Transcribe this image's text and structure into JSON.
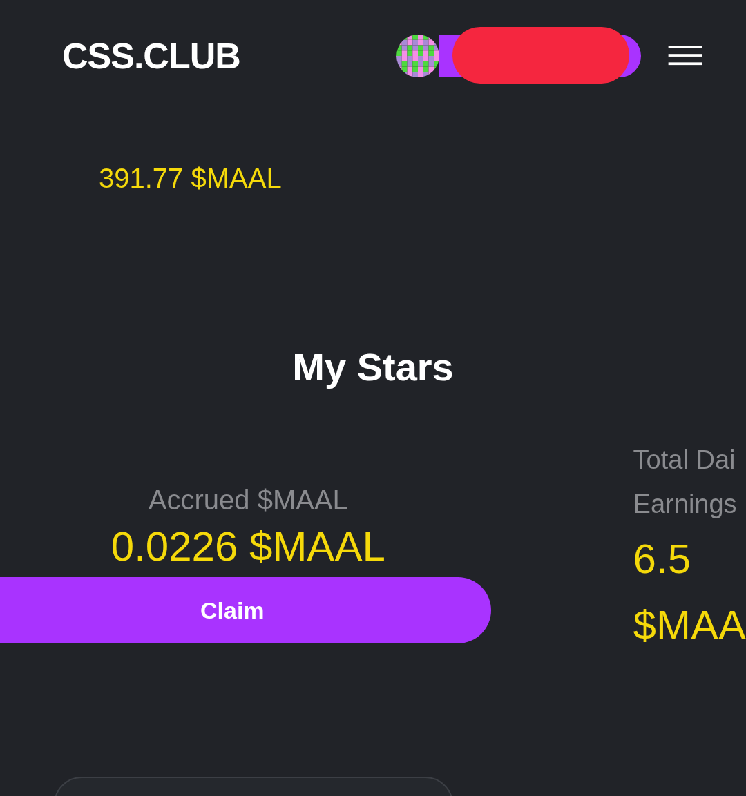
{
  "header": {
    "logo": "CSS.CLUB",
    "account": {
      "redacted": true
    }
  },
  "balance": "391.77 $MAAL",
  "title": "My Stars",
  "accrued": {
    "label": "Accrued $MAAL",
    "value": "0.0226 $MAAL",
    "button": "Claim"
  },
  "daily": {
    "label_lines": [
      "Total Dai",
      "Earnings"
    ],
    "value_lines": [
      "6.5",
      "$MAA"
    ]
  }
}
